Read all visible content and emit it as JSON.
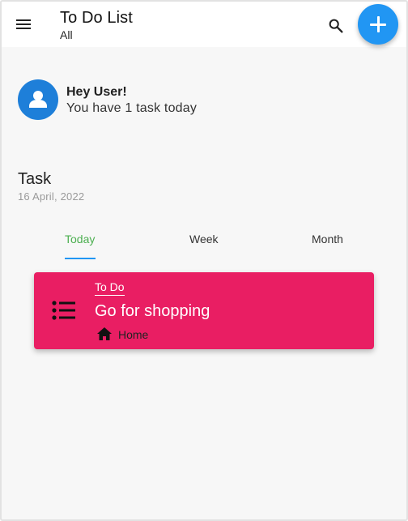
{
  "app_bar": {
    "title": "To Do List",
    "subtitle": "All"
  },
  "greeting": {
    "heading": "Hey User!",
    "message": "You have 1 task today"
  },
  "section": {
    "title": "Task",
    "date": "16 April, 2022"
  },
  "tabs": [
    {
      "label": "Today",
      "active": true
    },
    {
      "label": "Week",
      "active": false
    },
    {
      "label": "Month",
      "active": false
    }
  ],
  "tasks": [
    {
      "status": "To Do",
      "title": "Go for shopping",
      "category": "Home",
      "category_icon": "home-icon",
      "color": "#e91e63"
    }
  ],
  "colors": {
    "accent": "#2196f3",
    "active_tab": "#4caf50",
    "avatar": "#1e7fd9"
  },
  "icons": {
    "menu": "menu-icon",
    "search": "search-icon",
    "add": "add-icon",
    "avatar": "person-icon",
    "task": "list-icon"
  }
}
